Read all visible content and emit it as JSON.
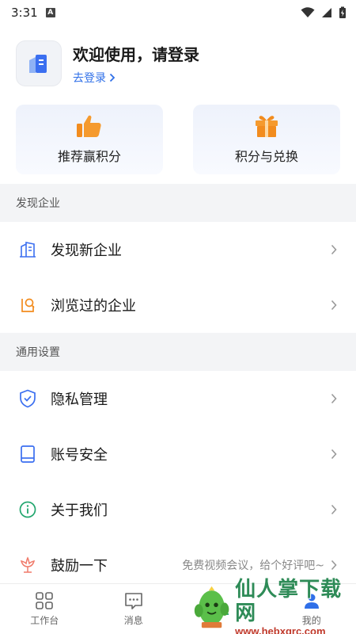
{
  "status_bar": {
    "time": "3:31",
    "notif_letter": "A"
  },
  "profile": {
    "welcome": "欢迎使用，请登录",
    "login_link": "去登录"
  },
  "cards": [
    {
      "label": "推荐赢积分",
      "icon": "thumbs-up-icon"
    },
    {
      "label": "积分与兑换",
      "icon": "gift-icon"
    }
  ],
  "sections": [
    {
      "title": "发现企业",
      "items": [
        {
          "label": "发现新企业",
          "icon": "building-icon"
        },
        {
          "label": "浏览过的企业",
          "icon": "history-icon"
        }
      ]
    },
    {
      "title": "通用设置",
      "items": [
        {
          "label": "隐私管理",
          "icon": "shield-icon"
        },
        {
          "label": "账号安全",
          "icon": "phone-icon"
        },
        {
          "label": "关于我们",
          "icon": "info-icon"
        },
        {
          "label": "鼓励一下",
          "icon": "flower-icon",
          "extra": "免费视频会议，给个好评吧~"
        }
      ]
    }
  ],
  "tabbar": [
    {
      "label": "工作台",
      "icon": "grid-icon"
    },
    {
      "label": "消息",
      "icon": "message-icon"
    },
    {
      "label": "",
      "icon": "download-icon"
    },
    {
      "label": "我的",
      "icon": "user-icon"
    }
  ],
  "watermark": {
    "title": "仙人掌下载网",
    "url": "www.hebxqrc.com"
  },
  "colors": {
    "accent": "#2f6fe8",
    "orange": "#f28c1e",
    "green": "#22a66e",
    "section_bg": "#f3f4f6"
  }
}
